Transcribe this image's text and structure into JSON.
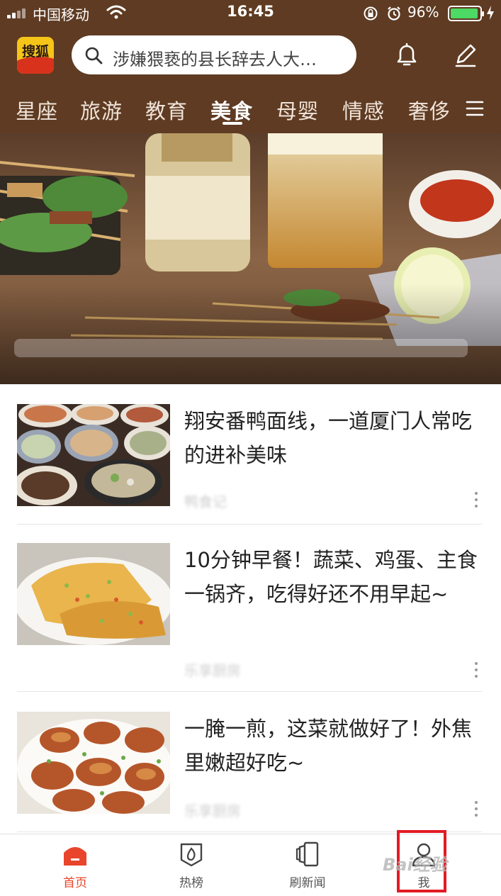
{
  "status_bar": {
    "carrier": "中国移动",
    "time": "16:45",
    "battery_percent": "96%",
    "battery_level": 0.96,
    "battery_color": "#4cd964"
  },
  "header": {
    "logo_text": "搜狐",
    "logo_color": "#f5c518",
    "background_color": "#5e3b22",
    "search_placeholder": "涉嫌猥亵的县长辞去人大…",
    "icons": [
      "bell-icon",
      "edit-icon"
    ]
  },
  "channels": {
    "items": [
      "星座",
      "旅游",
      "教育",
      "美食",
      "母婴",
      "情感",
      "奢侈"
    ],
    "active": "美食",
    "menu_icon": "hamburger-icon"
  },
  "banner": {
    "carousel_total": 4,
    "carousel_index": 1
  },
  "feed": [
    {
      "title": "翔安番鸭面线，一道厦门人常吃的进补美味",
      "thumb": "seafood-dishes-photo"
    },
    {
      "title": "10分钟早餐！蔬菜、鸡蛋、主食一锅齐，吃得好还不用早起~",
      "thumb": "egg-pancake-photo"
    },
    {
      "title": "一腌一煎，这菜就做好了！外焦里嫩超好吃~",
      "thumb": "fried-chicken-wings-photo"
    }
  ],
  "tabbar": {
    "items": [
      {
        "label": "首页",
        "icon": "home-icon",
        "active": true
      },
      {
        "label": "热榜",
        "icon": "fire-icon",
        "active": false
      },
      {
        "label": "刷新闻",
        "icon": "cards-icon",
        "active": false
      },
      {
        "label": "我",
        "icon": "profile-icon",
        "active": false
      }
    ],
    "accent_color": "#e8452c",
    "highlight_color": "#e21b23"
  },
  "watermark": "Bai经验"
}
